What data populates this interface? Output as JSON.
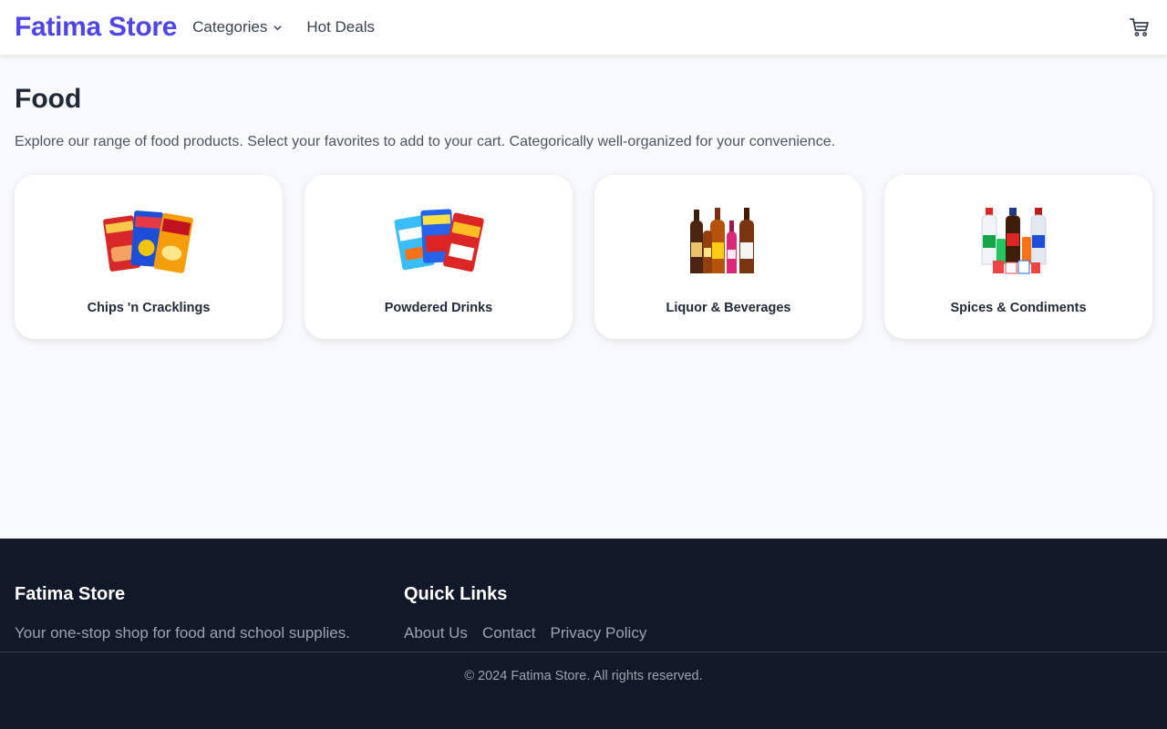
{
  "nav": {
    "brand": "Fatima Store",
    "categories_label": "Categories",
    "hot_deals_label": "Hot Deals",
    "cart_icon": "cart-icon",
    "chevron_icon": "chevron-down-icon"
  },
  "page": {
    "title": "Food",
    "description": "Explore our range of food products. Select your favorites to add to your cart. Categorically well-organized for your convenience."
  },
  "categories": [
    {
      "label": "Chips 'n Cracklings",
      "image": "chips-snacks-image"
    },
    {
      "label": "Powdered Drinks",
      "image": "powdered-drinks-image"
    },
    {
      "label": "Liquor & Beverages",
      "image": "liquor-bottles-image"
    },
    {
      "label": "Spices & Condiments",
      "image": "condiments-bottles-image"
    }
  ],
  "footer": {
    "brand": "Fatima Store",
    "tagline": "Your one-stop shop for food and school supplies.",
    "quick_links_title": "Quick Links",
    "links": [
      "About Us",
      "Contact",
      "Privacy Policy"
    ],
    "copyright": "© 2024 Fatima Store. All rights reserved."
  },
  "colors": {
    "brand": "#4f46e5",
    "footer_bg": "#111827",
    "page_bg": "#f8f9fb"
  }
}
